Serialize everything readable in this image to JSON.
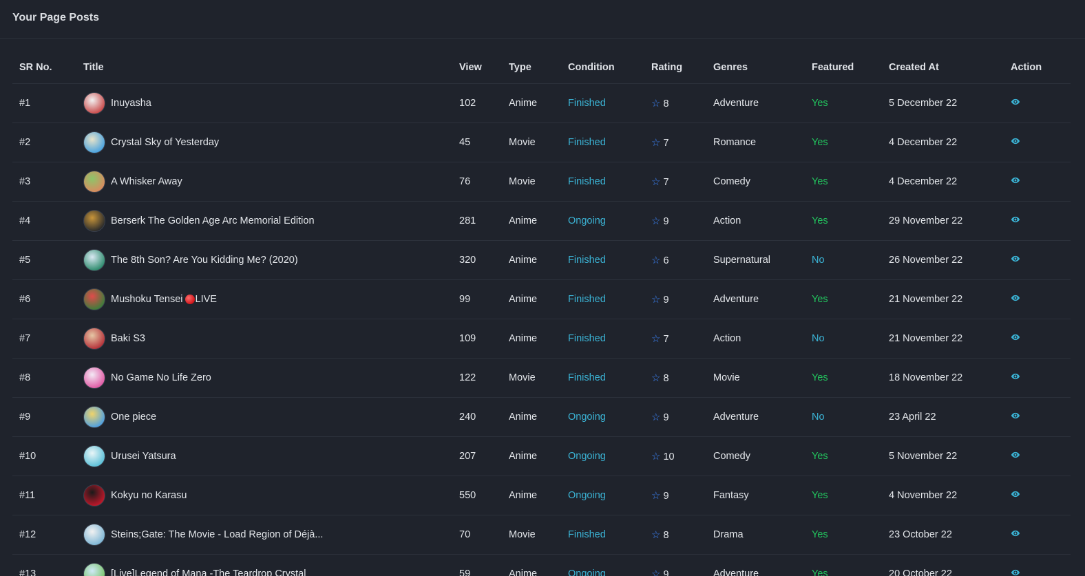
{
  "page": {
    "title": "Your Page Posts"
  },
  "colors": {
    "background": "#1f232c",
    "condition": "#3bb4d6",
    "featured_yes": "#22c55e",
    "featured_no": "#3bb4d6",
    "rating_star": "#3b82f6",
    "action_icon": "#3bb4d6"
  },
  "table": {
    "headers": {
      "sr": "SR No.",
      "title": "Title",
      "view": "View",
      "type": "Type",
      "condition": "Condition",
      "rating": "Rating",
      "genres": "Genres",
      "featured": "Featured",
      "created": "Created At",
      "action": "Action"
    },
    "rows": [
      {
        "sr": "#1",
        "title": "Inuyasha",
        "view": "102",
        "type": "Anime",
        "condition": "Finished",
        "rating": "8",
        "genre": "Adventure",
        "featured": "Yes",
        "created": "5 December 22",
        "thumb": [
          "#c94b4b",
          "#f2f2f2"
        ],
        "live": false
      },
      {
        "sr": "#2",
        "title": "Crystal Sky of Yesterday",
        "view": "45",
        "type": "Movie",
        "condition": "Finished",
        "rating": "7",
        "genre": "Romance",
        "featured": "Yes",
        "created": "4 December 22",
        "thumb": [
          "#4aa3df",
          "#e8e3c9"
        ],
        "live": false
      },
      {
        "sr": "#3",
        "title": "A Whisker Away",
        "view": "76",
        "type": "Movie",
        "condition": "Finished",
        "rating": "7",
        "genre": "Comedy",
        "featured": "Yes",
        "created": "4 December 22",
        "thumb": [
          "#d98b5f",
          "#8cc56a"
        ],
        "live": false
      },
      {
        "sr": "#4",
        "title": "Berserk The Golden Age Arc Memorial Edition",
        "view": "281",
        "type": "Anime",
        "condition": "Ongoing",
        "rating": "9",
        "genre": "Action",
        "featured": "Yes",
        "created": "29 November 22",
        "thumb": [
          "#2b2b2b",
          "#c8953a"
        ],
        "live": false
      },
      {
        "sr": "#5",
        "title": "The 8th Son? Are You Kidding Me? (2020)",
        "view": "320",
        "type": "Anime",
        "condition": "Finished",
        "rating": "6",
        "genre": "Supernatural",
        "featured": "No",
        "created": "26 November 22",
        "thumb": [
          "#2f8c6e",
          "#d9e8f2"
        ],
        "live": false
      },
      {
        "sr": "#6",
        "title": "Mushoku Tensei",
        "title_suffix": "LIVE",
        "view": "99",
        "type": "Anime",
        "condition": "Finished",
        "rating": "9",
        "genre": "Adventure",
        "featured": "Yes",
        "created": "21 November 22",
        "thumb": [
          "#3d7d3b",
          "#e04b4b"
        ],
        "live": true
      },
      {
        "sr": "#7",
        "title": "Baki S3",
        "view": "109",
        "type": "Anime",
        "condition": "Finished",
        "rating": "7",
        "genre": "Action",
        "featured": "No",
        "created": "21 November 22",
        "thumb": [
          "#b5323a",
          "#e6c7a5"
        ],
        "live": false
      },
      {
        "sr": "#8",
        "title": "No Game No Life Zero",
        "view": "122",
        "type": "Movie",
        "condition": "Finished",
        "rating": "8",
        "genre": "Movie",
        "featured": "Yes",
        "created": "18 November 22",
        "thumb": [
          "#e05ba5",
          "#f3e9f5"
        ],
        "live": false
      },
      {
        "sr": "#9",
        "title": "One piece",
        "view": "240",
        "type": "Anime",
        "condition": "Ongoing",
        "rating": "9",
        "genre": "Adventure",
        "featured": "No",
        "created": "23 April 22",
        "thumb": [
          "#4fa0e0",
          "#f0d46a"
        ],
        "live": false
      },
      {
        "sr": "#10",
        "title": "Urusei Yatsura",
        "view": "207",
        "type": "Anime",
        "condition": "Ongoing",
        "rating": "10",
        "genre": "Comedy",
        "featured": "Yes",
        "created": "5 November 22",
        "thumb": [
          "#5cc0d8",
          "#e9f5f7"
        ],
        "live": false
      },
      {
        "sr": "#11",
        "title": "Kokyu no Karasu",
        "view": "550",
        "type": "Anime",
        "condition": "Ongoing",
        "rating": "9",
        "genre": "Fantasy",
        "featured": "Yes",
        "created": "4 November 22",
        "thumb": [
          "#c0182a",
          "#1a1a1a"
        ],
        "live": false
      },
      {
        "sr": "#12",
        "title": "Steins;Gate: The Movie - Load Region of Déjà...",
        "view": "70",
        "type": "Movie",
        "condition": "Finished",
        "rating": "8",
        "genre": "Drama",
        "featured": "Yes",
        "created": "23 October 22",
        "thumb": [
          "#7fb7d6",
          "#f1f1f1"
        ],
        "live": false
      },
      {
        "sr": "#13",
        "title": "[Live]Legend of Mana -The Teardrop Crystal",
        "view": "59",
        "type": "Anime",
        "condition": "Ongoing",
        "rating": "9",
        "genre": "Adventure",
        "featured": "Yes",
        "created": "20 October 22",
        "thumb": [
          "#7ac46a",
          "#cfe9f7"
        ],
        "live": false
      }
    ]
  }
}
